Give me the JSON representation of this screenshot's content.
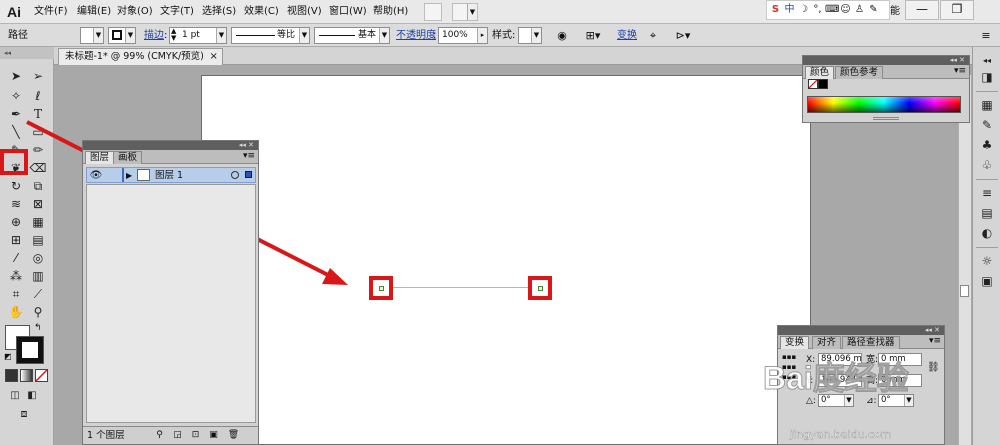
{
  "app": {
    "logo": "Ai",
    "menu": [
      "文件(F)",
      "编辑(E)",
      "对象(O)",
      "文字(T)",
      "选择(S)",
      "效果(C)",
      "视图(V)",
      "窗口(W)",
      "帮助(H)"
    ],
    "tray_text": "中",
    "tray_overflow_text": "能",
    "window_controls": [
      "—",
      "❐"
    ]
  },
  "control_bar": {
    "selection_label": "路径",
    "stroke_link": "描边",
    "stroke_weight": "1 pt",
    "profile_label": "等比",
    "brush_label": "基本",
    "opacity_link": "不透明度",
    "opacity_value": "100%",
    "style_label": "样式:",
    "transform_link": "变换"
  },
  "document": {
    "tab_title": "未标题-1* @ 99% (CMYK/预览)",
    "tab_close": "×"
  },
  "layers_panel": {
    "collapse": "◂◂ ✕",
    "tabs": [
      "图层",
      "画板"
    ],
    "menu_icon": "▾≡",
    "layer_name": "图层 1",
    "footer_count": "1 个图层"
  },
  "color_panel": {
    "collapse": "◂◂ ✕",
    "tabs": [
      "颜色",
      "颜色参考"
    ],
    "menu_icon": "▾≡"
  },
  "transform_panel": {
    "collapse": "◂◂ ✕",
    "tabs": [
      "变换",
      "对齐",
      "路径查找器"
    ],
    "menu_icon": "▾≡",
    "x_label": "X:",
    "x_value": "89.096 m",
    "y_label": "Y:",
    "y_value": "103.947 m",
    "w_label": "宽:",
    "w_value": "0 mm",
    "h_label": "高:",
    "h_value": "0 mm",
    "rotate_label": "△:",
    "rotate_value": "0°",
    "shear_label": "⊿:",
    "shear_value": "0°"
  },
  "watermark": {
    "logo": "Bai度经验",
    "url": "jingyan.baidu.com"
  },
  "colors": {
    "highlight_red": "#d81818",
    "path_green": "#8fd08a",
    "selection_blue": "#b8cdea",
    "link_blue": "#1c3fa8"
  }
}
